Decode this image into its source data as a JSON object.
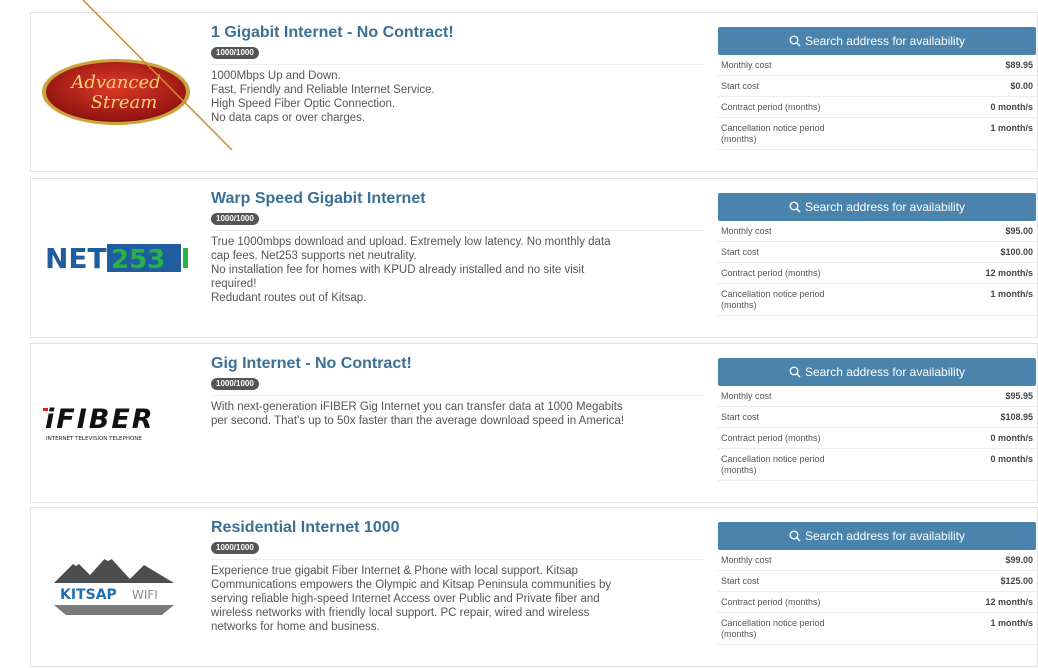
{
  "search_button_label": "Search address for availability",
  "labels": {
    "monthly": "Monthly cost",
    "start": "Start cost",
    "contract": "Contract period (months)",
    "cancel": "Cancellation notice period (months)"
  },
  "providers": [
    {
      "logo_text": "Advanced Stream",
      "title": "1 Gigabit Internet - No Contract!",
      "speed": "1000/1000",
      "desc": [
        "1000Mbps Up and Down.",
        "Fast, Friendly and Reliable Internet Service.",
        "High Speed Fiber Optic Connection.",
        "No data caps or over charges."
      ],
      "monthly": "$89.95",
      "start": "$0.00",
      "contract": "0 month/s",
      "cancel": "1 month/s"
    },
    {
      "logo_text": "NET253",
      "title": "Warp Speed Gigabit Internet",
      "speed": "1000/1000",
      "desc": [
        "True 1000mbps download and upload. Extremely low latency.  No monthly data",
        "cap fees. Net253 supports net neutrality.",
        "No installation fee for homes with KPUD already installed and no site visit",
        "required!",
        "Redudant routes out of Kitsap."
      ],
      "monthly": "$95.00",
      "start": "$100.00",
      "contract": "12 month/s",
      "cancel": "1 month/s"
    },
    {
      "logo_text": "iFIBER",
      "logo_sub": "INTERNET TELEVISION TELEPHONE",
      "title": "Gig Internet - No Contract!",
      "speed": "1000/1000",
      "desc": [
        "With next-generation iFIBER Gig Internet you can transfer data at 1000 Megabits",
        "per second. That's up to 50x faster than the average download speed in America!"
      ],
      "monthly": "$95.95",
      "start": "$108.95",
      "contract": "0 month/s",
      "cancel": "0 month/s"
    },
    {
      "logo_text": "KITSAP WIFI",
      "title": "Residential Internet 1000",
      "speed": "1000/1000",
      "desc": [
        "Experience true gigabit Fiber Internet & Phone with local support.  Kitsap",
        "Communications empowers the Olympic and Kitsap Peninsula communities by",
        "serving reliable high-speed Internet Access over Public and Private fiber and",
        "wireless networks with friendly local support. PC repair, wired and wireless",
        "networks for home and business."
      ],
      "monthly": "$99.00",
      "start": "$125.00",
      "contract": "12 month/s",
      "cancel": "1 month/s"
    }
  ]
}
